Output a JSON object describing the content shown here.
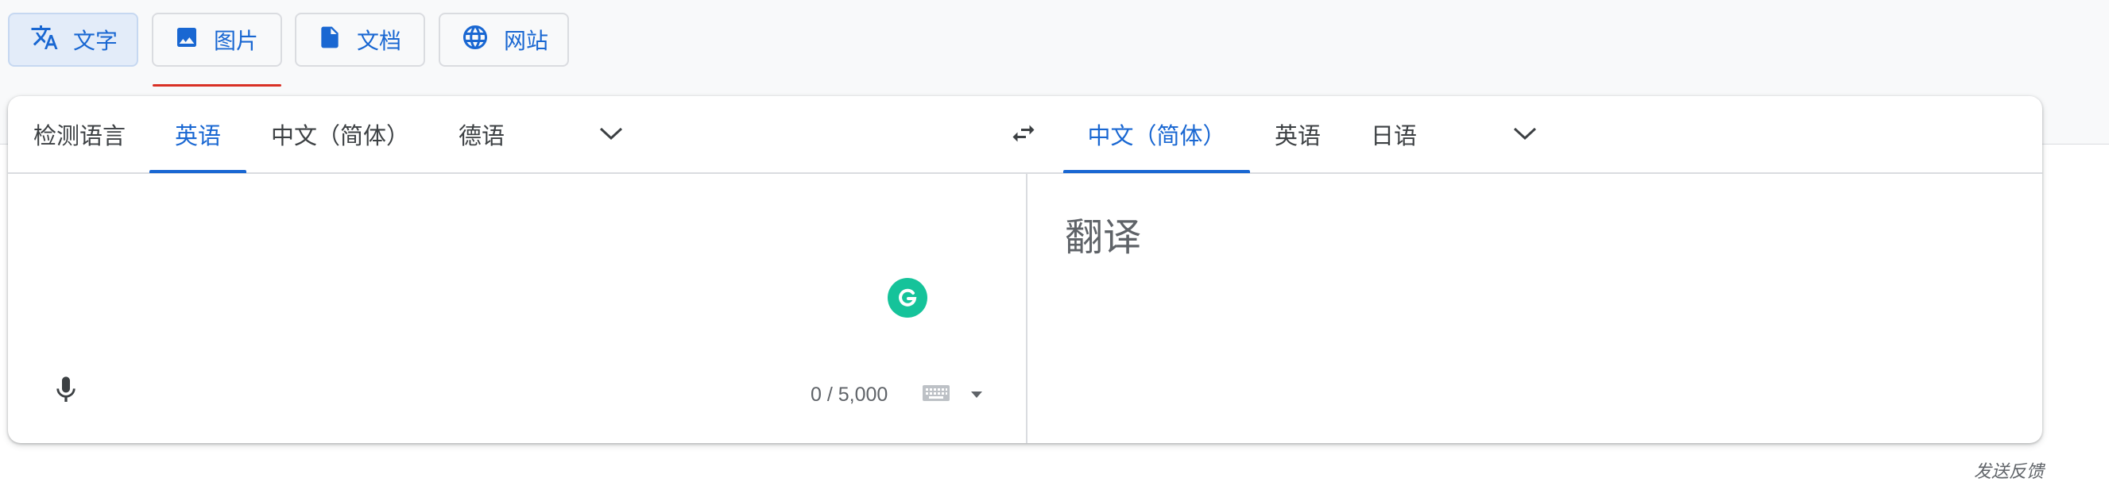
{
  "modes": [
    {
      "label": "文字",
      "icon": "translate-icon",
      "active": true
    },
    {
      "label": "图片",
      "icon": "image-icon",
      "active": false
    },
    {
      "label": "文档",
      "icon": "document-icon",
      "active": false
    },
    {
      "label": "网站",
      "icon": "globe-icon",
      "active": false
    }
  ],
  "source_langs": [
    "检测语言",
    "英语",
    "中文（简体）",
    "德语"
  ],
  "source_active": "英语",
  "target_langs": [
    "中文（简体）",
    "英语",
    "日语"
  ],
  "target_active": "中文（简体）",
  "source": {
    "char_count": "0 / 5,000"
  },
  "target": {
    "placeholder": "翻译"
  },
  "footer": {
    "feedback": "发送反馈"
  },
  "colors": {
    "accent": "#1967d2",
    "underline_red": "#d93025",
    "grammarly": "#15c39a"
  }
}
